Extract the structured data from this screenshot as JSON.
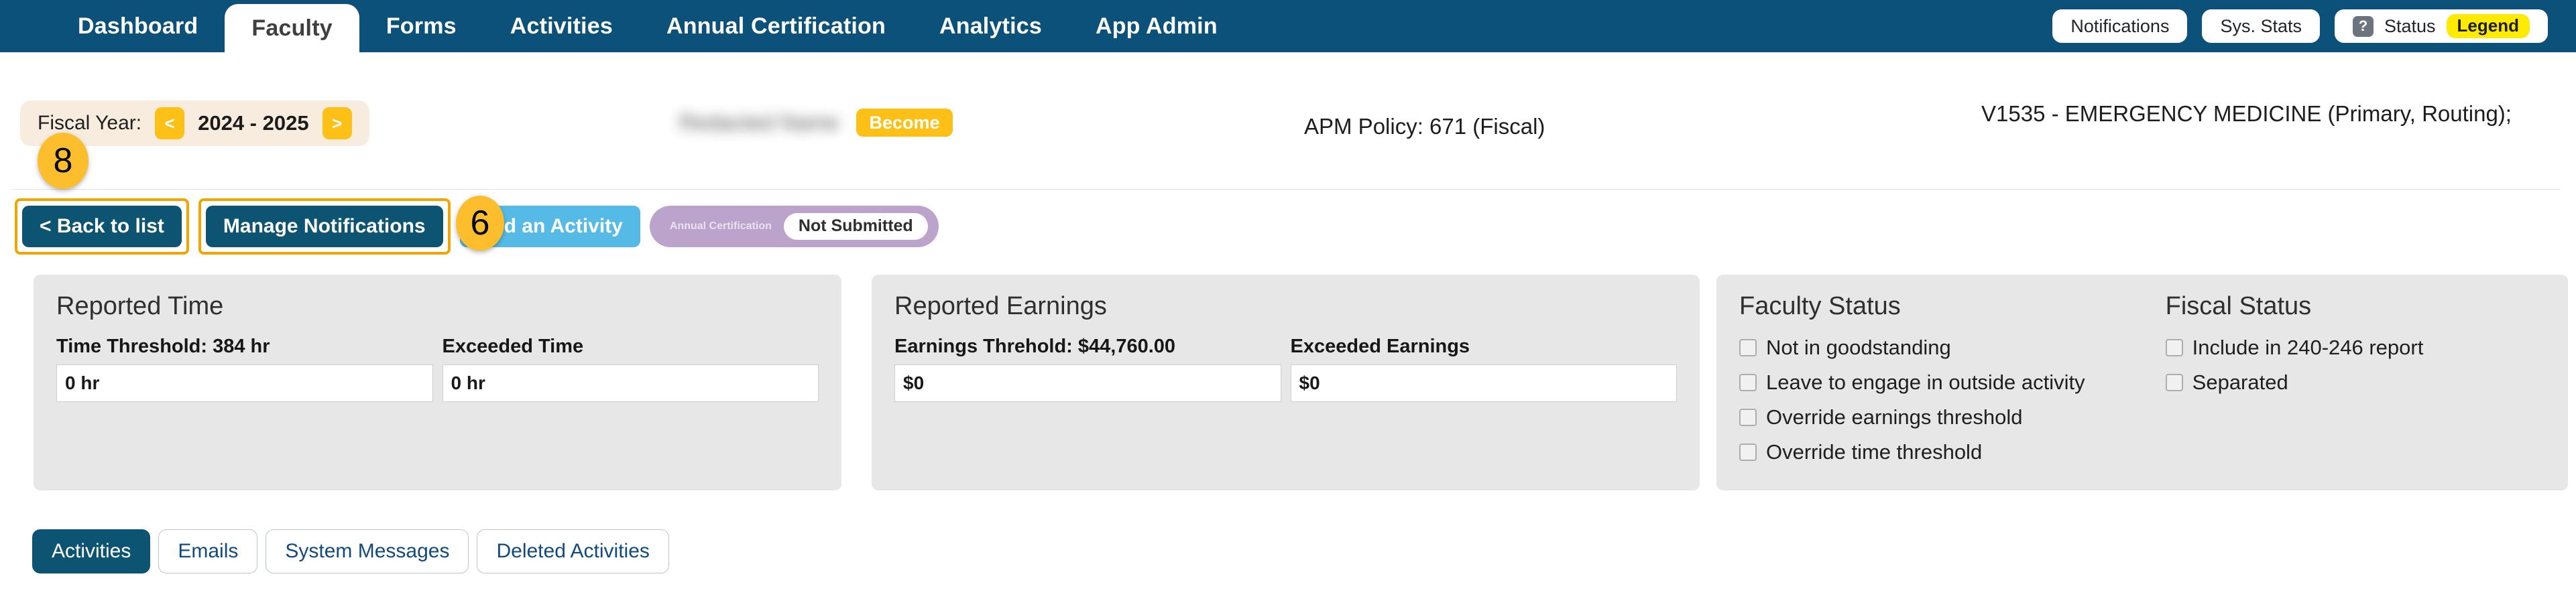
{
  "navbar": {
    "items": [
      {
        "label": "Dashboard",
        "active": false
      },
      {
        "label": "Faculty",
        "active": true
      },
      {
        "label": "Forms",
        "active": false
      },
      {
        "label": "Activities",
        "active": false
      },
      {
        "label": "Annual Certification",
        "active": false
      },
      {
        "label": "Analytics",
        "active": false
      },
      {
        "label": "App Admin",
        "active": false
      }
    ],
    "notifications_label": "Notifications",
    "sys_stats_label": "Sys. Stats",
    "status_label": "Status",
    "legend_label": "Legend",
    "help_icon": "question-mark-icon",
    "background_color": "#0c5179"
  },
  "fiscal": {
    "label": "Fiscal Year:",
    "prev_label": "<",
    "next_label": ">",
    "value": "2024 - 2025",
    "background_color": "#f8ecdf",
    "button_color": "#fcc017"
  },
  "person": {
    "name": "",
    "become_label": "Become",
    "apm_policy": "APM Policy: 671 (Fiscal)",
    "department": "V1535 - EMERGENCY MEDICINE (Primary, Routing);"
  },
  "actions": {
    "back_label": "< Back to list",
    "manage_notifications_label": "Manage Notifications",
    "add_activity_label": "Add an Activity",
    "annual_certification_label": "Annual Certification",
    "annual_certification_status": "Not Submitted",
    "highlight_color": "#f0a500"
  },
  "cards": {
    "reported_time": {
      "title": "Reported Time",
      "fields": [
        {
          "label": "Time Threshold: 384 hr",
          "value": "0 hr"
        },
        {
          "label": "Exceeded Time",
          "value": "0 hr"
        }
      ]
    },
    "reported_earnings": {
      "title": "Reported Earnings",
      "fields": [
        {
          "label": "Earnings Threhold: $44,760.00",
          "value": "$0"
        },
        {
          "label": "Exceeded Earnings",
          "value": "$0"
        }
      ]
    },
    "faculty_status": {
      "title": "Faculty Status",
      "checkboxes": [
        {
          "label": "Not in goodstanding",
          "checked": false
        },
        {
          "label": "Leave to engage in outside activity",
          "checked": false
        },
        {
          "label": "Override earnings threshold",
          "checked": false
        },
        {
          "label": "Override time threshold",
          "checked": false
        }
      ]
    },
    "fiscal_status": {
      "title": "Fiscal Status",
      "checkboxes": [
        {
          "label": "Include in 240-246 report",
          "checked": false
        },
        {
          "label": "Separated",
          "checked": false
        }
      ]
    }
  },
  "tabs": [
    {
      "label": "Activities",
      "active": true
    },
    {
      "label": "Emails",
      "active": false
    },
    {
      "label": "System Messages",
      "active": false
    },
    {
      "label": "Deleted Activities",
      "active": false
    }
  ],
  "markers": [
    {
      "id": "8",
      "label": "8"
    },
    {
      "id": "6",
      "label": "6"
    }
  ]
}
